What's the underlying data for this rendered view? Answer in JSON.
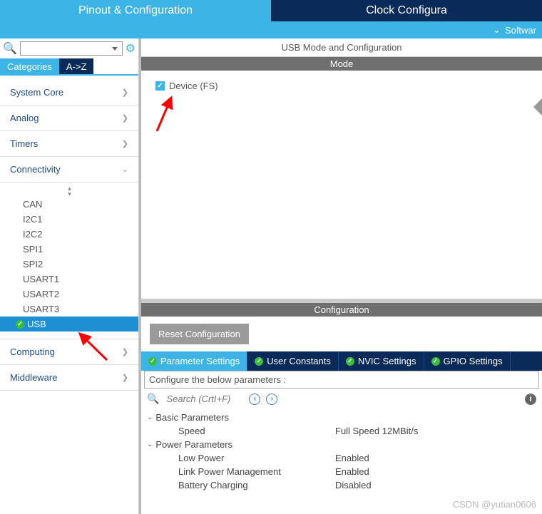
{
  "topTabs": {
    "active": "Pinout & Configuration",
    "inactive": "Clock Configura"
  },
  "subBar": {
    "label": "Softwar"
  },
  "search": {
    "placeholder": ""
  },
  "catTabs": {
    "cat": "Categories",
    "az": "A->Z"
  },
  "categories": {
    "systemCore": "System Core",
    "analog": "Analog",
    "timers": "Timers",
    "connectivity": "Connectivity",
    "computing": "Computing",
    "middleware": "Middleware"
  },
  "connectivityItems": [
    "CAN",
    "I2C1",
    "I2C2",
    "SPI1",
    "SPI2",
    "USART1",
    "USART2",
    "USART3"
  ],
  "selectedItem": "USB",
  "rightTitle": "USB Mode and Configuration",
  "modeBar": "Mode",
  "modeCheckbox": "Device (FS)",
  "configBar": "Configuration",
  "resetBtn": "Reset Configuration",
  "cfgTabs": {
    "param": "Parameter Settings",
    "user": "User Constants",
    "nvic": "NVIC Settings",
    "gpio": "GPIO Settings"
  },
  "paramHeader": "Configure the below parameters :",
  "paramSearch": {
    "placeholder": "Search (CrtI+F)"
  },
  "tree": {
    "basic": {
      "title": "Basic Parameters",
      "rows": [
        {
          "label": "Speed",
          "value": "Full Speed 12MBit/s"
        }
      ]
    },
    "power": {
      "title": "Power Parameters",
      "rows": [
        {
          "label": "Low Power",
          "value": "Enabled"
        },
        {
          "label": "Link Power Management",
          "value": "Enabled"
        },
        {
          "label": "Battery Charging",
          "value": "Disabled"
        }
      ]
    }
  },
  "watermark": "CSDN @yutian0606"
}
